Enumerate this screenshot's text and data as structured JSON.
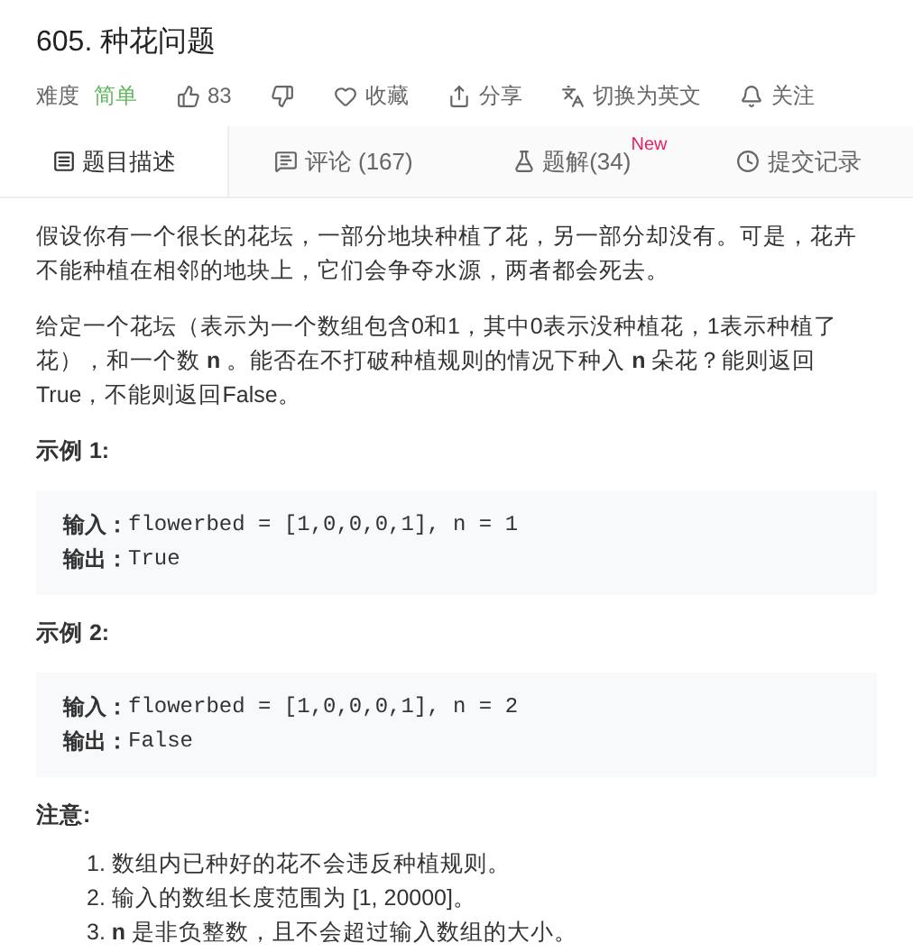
{
  "title": "605. 种花问题",
  "meta": {
    "difficulty_label": "难度",
    "difficulty": "简单",
    "likes": "83"
  },
  "actions": [
    {
      "kind": "dislike"
    },
    {
      "kind": "heart",
      "label": "收藏"
    },
    {
      "kind": "share",
      "label": "分享"
    },
    {
      "kind": "translate",
      "label": "切换为英文"
    },
    {
      "kind": "bell",
      "label": "关注"
    }
  ],
  "tabs": [
    {
      "kind": "description",
      "label": "题目描述",
      "selected": true
    },
    {
      "kind": "comment",
      "label": "评论 (167)",
      "selected": false
    },
    {
      "kind": "flask",
      "label": "题解(34)",
      "badge": "New",
      "selected": false
    },
    {
      "kind": "clock",
      "label": "提交记录",
      "selected": false
    }
  ],
  "paragraphs": [
    "假设你有一个很长的花坛，一部分地块种植了花，另一部分却没有。可是，花卉不能种植在相邻的地块上，它们会争夺水源，两者都会死去。",
    "给定一个花坛（表示为一个数组包含0和1，其中0表示没种植花，1表示种植了花），和一个数 **n** 。能否在不打破种植规则的情况下种入 **n** 朵花？能则返回True，不能则返回False。"
  ],
  "examples": [
    {
      "heading": "示例 1:",
      "lines": [
        {
          "label": "输入：",
          "value": "flowerbed = [1,0,0,0,1], n = 1"
        },
        {
          "label": "输出：",
          "value": "True"
        }
      ]
    },
    {
      "heading": "示例 2:",
      "lines": [
        {
          "label": "输入：",
          "value": "flowerbed = [1,0,0,0,1], n = 2"
        },
        {
          "label": "输出：",
          "value": "False"
        }
      ]
    }
  ],
  "notes": {
    "heading": "注意:",
    "items": [
      "1. 数组内已种好的花不会违反种植规则。",
      "2. 输入的数组长度范围为 [1, 20000]。",
      "3. **n** 是非负整数，且不会超过输入数组的大小。"
    ]
  }
}
